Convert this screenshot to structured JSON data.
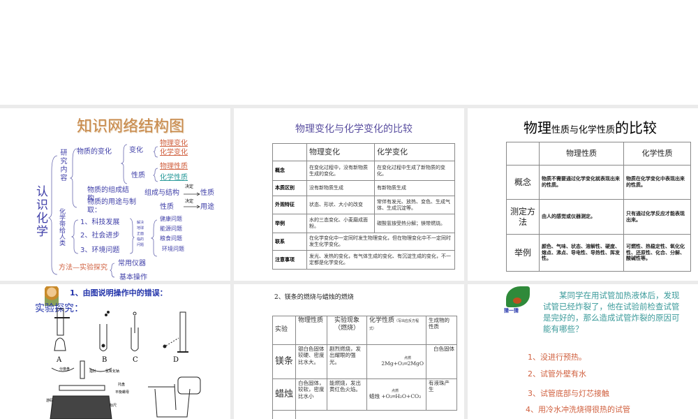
{
  "slide1": {
    "title": "知识网络结构图",
    "root": "认识化学",
    "research": "研究内容",
    "change_of_matter": "物质的变化",
    "change": "变化",
    "physical_change": "物理变化",
    "chemical_change": "化学变化",
    "property": "性质",
    "physical_property": "物理性质",
    "chemical_property": "化学性质",
    "composition": "物质的组成结构",
    "use": "物质的用途与制取：",
    "comp_struct": "组成与结构",
    "decides": "决定",
    "property2": "性质",
    "property3": "性质",
    "decides2": "决定",
    "uses": "用途",
    "bring": "化学带给人类",
    "items": [
      "1、科技发展",
      "2、社会进步",
      "3、环境问题"
    ],
    "solve": "解决地球正面临的问题",
    "problems": [
      "健康问题",
      "能源问题",
      "粮食问题",
      "环境问题"
    ],
    "method": "方法—实验探究",
    "instruments": "常用仪器",
    "operations": "基本操作"
  },
  "slide2": {
    "title": "物理变化与化学变化的比较",
    "headers": [
      "",
      "物理变化",
      "化学变化"
    ],
    "rows": [
      {
        "label": "概念",
        "physical": "在变化过程中，没有新物质生成的变化。",
        "chemical": "在变化过程中生成了新物质的变化。"
      },
      {
        "label": "本质区别",
        "physical": "没有新物质生成",
        "chemical": "有新物质生成"
      },
      {
        "label": "外观特征",
        "physical": "状态、形状、大小的改变",
        "chemical": "常伴有发光、放热、变色、生成气体、生成沉淀等。"
      },
      {
        "label": "举例",
        "physical": "水的三态变化、小麦磨成面粉。",
        "chemical": "碳酸氢铵受热分解；镁带燃烧。"
      }
    ],
    "link": {
      "label": "联系",
      "text": "在化学变化中一定同时发生物理变化，但在物理变化中不一定同时发生化学变化。"
    },
    "note": {
      "label": "注意事项",
      "text": "发光、发热的变化，有气体生成的变化、有沉淀生成的变化，不一定都是化学变化。"
    }
  },
  "slide3": {
    "title_a": "物理",
    "title_b": "性质与化学性质",
    "title_c": "的比较",
    "headers": [
      "",
      "物理性质",
      "化学性质"
    ],
    "rows": [
      {
        "label": "概念",
        "physical": "物质不需要通过化学变化就表现出来的性质。",
        "chemical": "物质在化学变化中表现出来的性质。"
      },
      {
        "label": "测定方法",
        "physical": "由人的感觉或仪器测定。",
        "chemical": "只有通过化学反应才能表现出来。"
      },
      {
        "label": "举例",
        "physical": "颜色、气味、状态、溶解性、硬度、熔点、沸点、导电性、导热性、挥发性。",
        "chemical": "可燃性、热稳定性、氧化化性、还原性、化合、分解、酸碱性等。"
      }
    ]
  },
  "slide4": {
    "title": "1、由图说明操作中的错误：",
    "subtitle": "实验探究：",
    "labels": [
      "A",
      "B",
      "C",
      "D"
    ],
    "balance_labels": [
      "分度盘",
      "指针",
      "氢氧化钠",
      "托盘",
      "平衡螺母",
      "游码",
      "标尺"
    ]
  },
  "slide5": {
    "title": "2、镁条的燃烧与蜡烛的燃烧",
    "headers": [
      "实验",
      "物理性质",
      "实验现象（燃烧）",
      "化学性质",
      "（写出应反方程式）",
      "生成物的性质"
    ],
    "rows": [
      {
        "name": "镁条",
        "physical": "银白色固体较硬、密度比水大。",
        "phenomenon": "剧烈燃烧，发出耀眼的强光。",
        "equation": "2Mg+O₂═2MgO",
        "condition": "点燃",
        "product": "白色固体"
      },
      {
        "name": "蜡烛",
        "physical": "白色固体，较软，密度比水小",
        "phenomenon": "能燃烧，发出黄红色火焰。",
        "equation": "蜡烛 +O₂═H₂O+CO₂",
        "condition": "点燃",
        "product": "有液珠产生"
      }
    ]
  },
  "slide6": {
    "badge": "猜一猜",
    "question": "某同学在用试管加热液体后，发现试管已经炸裂了，他在试验前检查试管是完好的，那么造成试管炸裂的原因可能有哪些？",
    "answers": [
      "1、没进行预热。",
      "2、试管外壁有水",
      "3、试管底部与灯芯接触",
      "4、用冷水冲洗烧得很热的试管"
    ]
  }
}
